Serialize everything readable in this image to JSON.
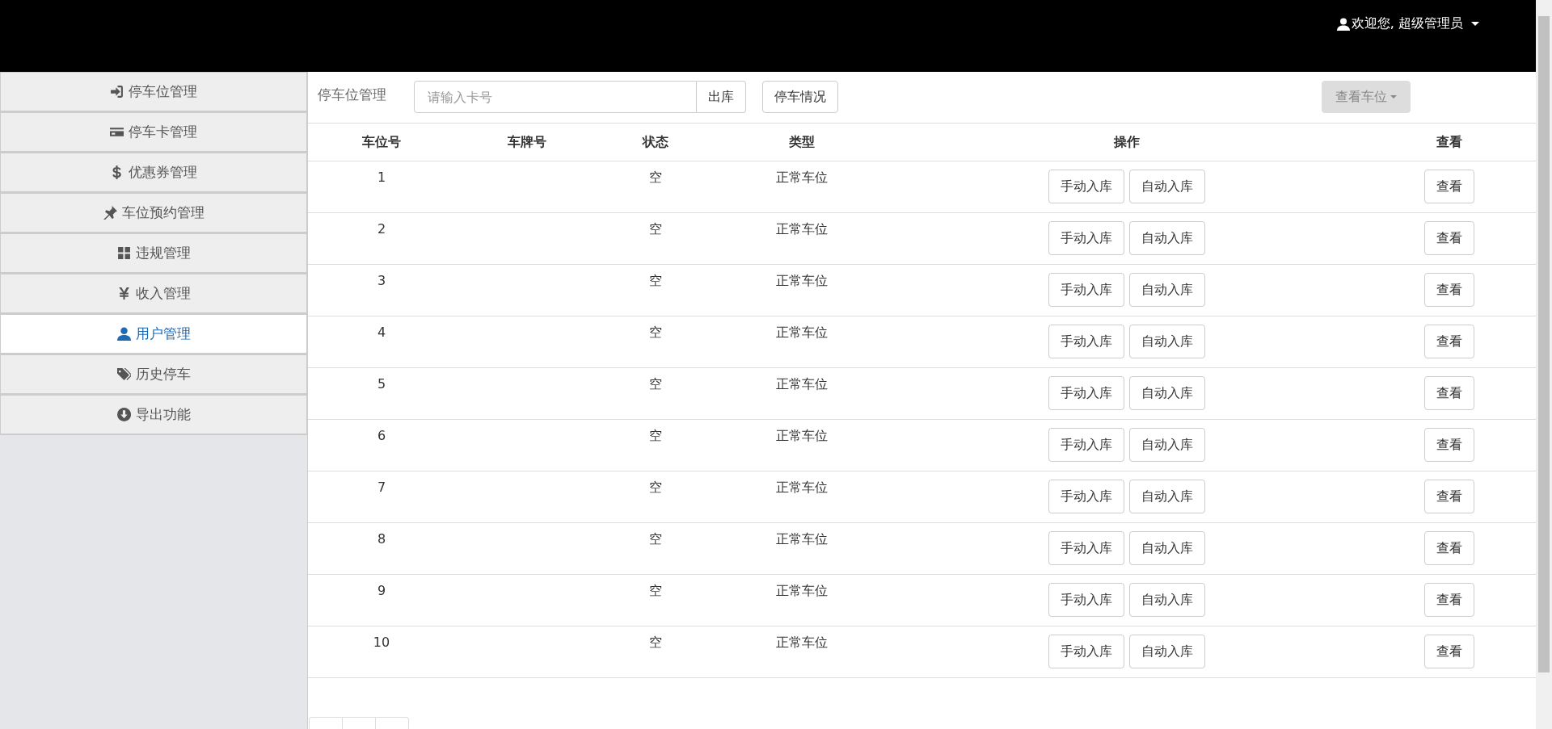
{
  "header": {
    "user_menu": "欢迎您, 超级管理员"
  },
  "sidebar": {
    "items": [
      {
        "label": "停车位管理",
        "selected": false
      },
      {
        "label": "停车卡管理",
        "selected": false
      },
      {
        "label": "优惠券管理",
        "selected": false
      },
      {
        "label": "车位预约管理",
        "selected": false
      },
      {
        "label": "违规管理",
        "selected": false
      },
      {
        "label": "收入管理",
        "selected": false
      },
      {
        "label": "用户管理",
        "selected": true
      },
      {
        "label": "历史停车",
        "selected": false
      },
      {
        "label": "导出功能",
        "selected": false
      }
    ]
  },
  "toolbar": {
    "title": "停车位管理",
    "card_input": {
      "placeholder": "请输入卡号"
    },
    "checkout_button": "出库",
    "status_button": "停车情况",
    "view_dropdown": {
      "label": "查看车位",
      "disabled": true
    }
  },
  "table": {
    "columns": [
      "车位号",
      "车牌号",
      "状态",
      "类型",
      "操作",
      "查看"
    ],
    "rows": [
      {
        "number": "1",
        "status": "空",
        "type": "正常车位",
        "actions": [
          "手动入库",
          "自动入库"
        ],
        "view": "查看"
      },
      {
        "number": "2",
        "status": "空",
        "type": "正常车位",
        "actions": [
          "手动入库",
          "自动入库"
        ],
        "view": "查看"
      },
      {
        "number": "3",
        "status": "空",
        "type": "正常车位",
        "actions": [
          "手动入库",
          "自动入库"
        ],
        "view": "查看"
      },
      {
        "number": "4",
        "status": "空",
        "type": "正常车位",
        "actions": [
          "手动入库",
          "自动入库"
        ],
        "view": "查看"
      },
      {
        "number": "5",
        "status": "空",
        "type": "正常车位",
        "actions": [
          "手动入库",
          "自动入库"
        ],
        "view": "查看"
      },
      {
        "number": "6",
        "status": "空",
        "type": "正常车位",
        "actions": [
          "手动入库",
          "自动入库"
        ],
        "view": "查看"
      },
      {
        "number": "7",
        "status": "空",
        "type": "正常车位",
        "actions": [
          "手动入库",
          "自动入库"
        ],
        "view": "查看"
      },
      {
        "number": "8",
        "status": "空",
        "type": "正常车位",
        "actions": [
          "手动入库",
          "自动入库"
        ],
        "view": "查看"
      },
      {
        "number": "9",
        "status": "空",
        "type": "正常车位",
        "actions": [
          "手动入库",
          "自动入库"
        ],
        "view": "查看"
      },
      {
        "number": "10",
        "status": "空",
        "type": "正常车位",
        "actions": [
          "手动入库",
          "自动入库"
        ],
        "view": "查看"
      }
    ]
  }
}
